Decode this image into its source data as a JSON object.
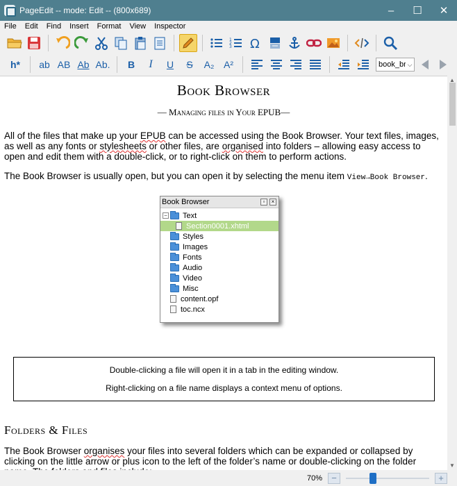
{
  "window": {
    "title": "PageEdit -- mode: Edit -- (800x689)",
    "controls": [
      "–",
      "☐",
      "✕"
    ]
  },
  "menu": [
    "File",
    "Edit",
    "Find",
    "Insert",
    "Format",
    "View",
    "Inspector"
  ],
  "toolbar1": {
    "icons": [
      "open-folder",
      "save",
      "undo",
      "redo",
      "cut",
      "copy",
      "paste",
      "paste-special",
      "edit-pencil",
      "bullet-list",
      "numbered-list",
      "insert-special-char",
      "insert-file",
      "insert-anchor",
      "insert-link",
      "insert-image",
      "view-code",
      "find"
    ]
  },
  "toolbar2": {
    "heading_label": "h*",
    "case_buttons": [
      "ab",
      "AB",
      "Ab",
      "Ab."
    ],
    "format_buttons": [
      "B",
      "I",
      "U",
      "S",
      "A₂",
      "A²"
    ],
    "style_combo_value": "book_bro",
    "style_combo_arrow": "⌵"
  },
  "document": {
    "title": "Book Browser",
    "subtitle": "— Managing files in Your EPUB—",
    "paragraph1": {
      "parts": [
        "All of the files that make up your ",
        "EPUB",
        " can be accessed using the Book Browser. Your text files, images, as well as any fonts or ",
        "stylesheets",
        " or other files, are ",
        "organised",
        " into folders – allowing easy access to open and edit them with a double-click, or to right-click on them to perform actions."
      ]
    },
    "paragraph2": {
      "text": "The Book Browser is usually open, but you can open it by selecting the menu item ",
      "menu_path": "View→Book Browser",
      "end": "."
    },
    "book_browser": {
      "title": "Book Browser",
      "items": [
        {
          "label": "Text",
          "type": "folder",
          "expanded": true
        },
        {
          "label": "Section0001.xhtml",
          "type": "file",
          "selected": true
        },
        {
          "label": "Styles",
          "type": "folder"
        },
        {
          "label": "Images",
          "type": "folder"
        },
        {
          "label": "Fonts",
          "type": "folder"
        },
        {
          "label": "Audio",
          "type": "folder"
        },
        {
          "label": "Video",
          "type": "folder"
        },
        {
          "label": "Misc",
          "type": "folder"
        },
        {
          "label": "content.opf",
          "type": "file"
        },
        {
          "label": "toc.ncx",
          "type": "file"
        }
      ]
    },
    "note": {
      "line1": "Double-clicking a file will open it in a tab in the editing window.",
      "line2": "Right-clicking on a file name displays a context menu of options."
    },
    "section_heading": "Folders & Files",
    "paragraph3": {
      "parts": [
        "The Book Browser ",
        "organises",
        " your files into several folders which can be expanded or collapsed by clicking on the little arrow or plus icon to the left of the folder’s name or double-clicking on the folder name. The folders and files include:"
      ]
    }
  },
  "status": {
    "zoom": "70%",
    "zoom_fraction": 0.31,
    "zoom_out": "−",
    "zoom_in": "+"
  },
  "colors": {
    "titlebar": "#4f7f8f",
    "selection": "#b2d88a",
    "toolbar_icon_blue": "#1b5fa8",
    "active_tool": "#f5d56a",
    "zoom_handle": "#1f6fc5"
  }
}
